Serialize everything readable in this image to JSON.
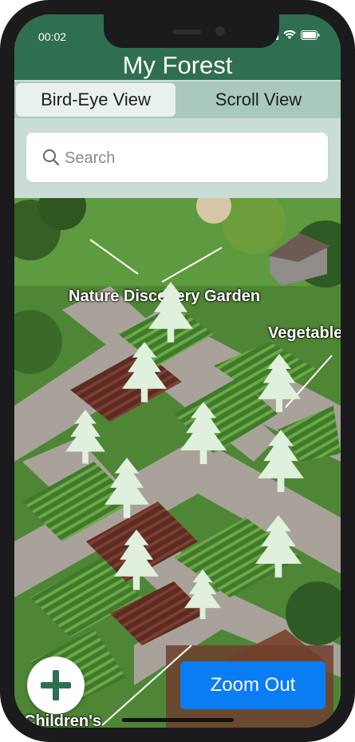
{
  "status_bar": {
    "time": "00:02"
  },
  "app": {
    "title": "My Forest"
  },
  "tabs": [
    {
      "label": "Bird-Eye View",
      "active": true
    },
    {
      "label": "Scroll View",
      "active": false
    }
  ],
  "search": {
    "placeholder": "Search",
    "value": ""
  },
  "map": {
    "labels": {
      "nature_garden": "Nature Discovery Garden",
      "vegetable": "Vegetable",
      "children": "Children's"
    },
    "tree_count": 11,
    "tree_color": "#dff0dc"
  },
  "buttons": {
    "add_icon": "plus-icon",
    "zoom_out": "Zoom Out"
  },
  "colors": {
    "header": "#2f6e50",
    "tab_bar": "#a9c9bd",
    "active_tab": "#e9f1ee",
    "search_area": "#c9dcd5",
    "zoom_button": "#0a7cf4"
  }
}
